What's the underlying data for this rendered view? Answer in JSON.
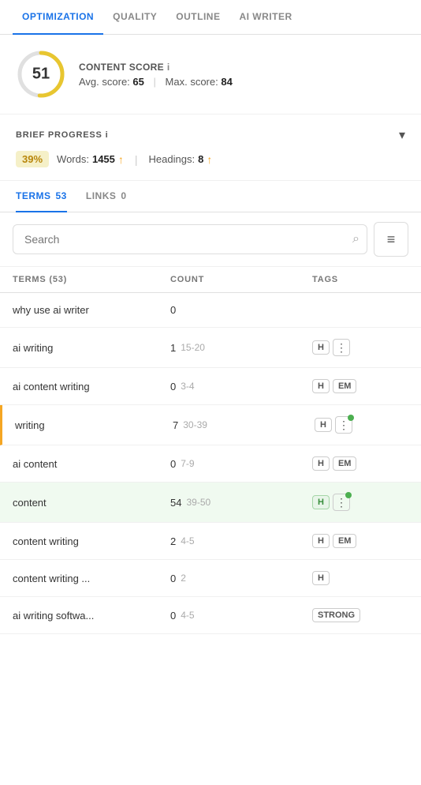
{
  "nav": {
    "tabs": [
      {
        "id": "optimization",
        "label": "OPTIMIZATION",
        "active": true
      },
      {
        "id": "quality",
        "label": "QUALITY",
        "active": false
      },
      {
        "id": "outline",
        "label": "OUTLINE",
        "active": false
      },
      {
        "id": "ai_writer",
        "label": "AI WRITER",
        "active": false
      }
    ]
  },
  "content_score": {
    "label": "CONTENT SCORE",
    "info_icon": "i",
    "score": "51",
    "avg_label": "Avg. score:",
    "avg_value": "65",
    "separator": "|",
    "max_label": "Max. score:",
    "max_value": "84",
    "circle_value": 51,
    "circle_max": 100,
    "stroke_color": "#e8c630",
    "track_color": "#e0e0e0"
  },
  "brief_progress": {
    "title": "BRIEF PROGRESS",
    "info_icon": "i",
    "percentage": "39%",
    "words_label": "Words:",
    "words_value": "1455",
    "headings_label": "Headings:",
    "headings_value": "8"
  },
  "sub_tabs": [
    {
      "id": "terms",
      "label": "TERMS",
      "count": "53",
      "active": true
    },
    {
      "id": "links",
      "label": "LINKS",
      "count": "0",
      "active": false
    }
  ],
  "search": {
    "placeholder": "Search"
  },
  "table": {
    "columns": [
      "TERMS (53)",
      "COUNT",
      "TAGS"
    ],
    "rows": [
      {
        "term": "why use ai writer",
        "count": "0",
        "range": "",
        "tags": [],
        "has_menu": false,
        "highlighted": false,
        "warning": false
      },
      {
        "term": "ai writing",
        "count": "1",
        "range": "15-20",
        "tags": [
          "H"
        ],
        "has_menu": true,
        "dot": false,
        "highlighted": false,
        "warning": false
      },
      {
        "term": "ai content writing",
        "count": "0",
        "range": "3-4",
        "tags": [
          "H",
          "EM"
        ],
        "has_menu": false,
        "highlighted": false,
        "warning": false
      },
      {
        "term": "writing",
        "count": "7",
        "range": "30-39",
        "tags": [
          "H"
        ],
        "has_menu": true,
        "dot": true,
        "highlighted": false,
        "warning": true
      },
      {
        "term": "ai content",
        "count": "0",
        "range": "7-9",
        "tags": [
          "H",
          "EM"
        ],
        "has_menu": false,
        "highlighted": false,
        "warning": false
      },
      {
        "term": "content",
        "count": "54",
        "range": "39-50",
        "tags": [
          "H"
        ],
        "has_menu": true,
        "dot": true,
        "highlighted": true,
        "warning": false
      },
      {
        "term": "content writing",
        "count": "2",
        "range": "4-5",
        "tags": [
          "H",
          "EM"
        ],
        "has_menu": false,
        "highlighted": false,
        "warning": false
      },
      {
        "term": "content writing ...",
        "count": "0",
        "range": "2",
        "tags": [
          "H"
        ],
        "has_menu": false,
        "highlighted": false,
        "warning": false
      },
      {
        "term": "ai writing softwa...",
        "count": "0",
        "range": "4-5",
        "tags": [
          "STRONG"
        ],
        "has_menu": false,
        "highlighted": false,
        "warning": false
      }
    ]
  },
  "icons": {
    "search": "🔍",
    "filter": "☰",
    "arrow_up": "↑",
    "chevron_down": "▾",
    "three_dots": "⋮"
  }
}
